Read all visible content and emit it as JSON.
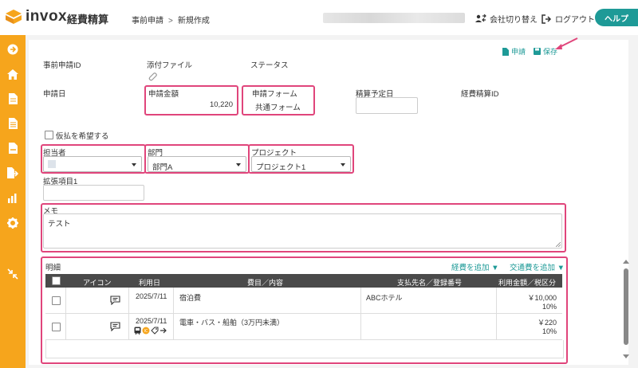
{
  "header": {
    "logo_text": "invox",
    "logo_sub": "経費精算",
    "breadcrumb": [
      "事前申請",
      "新規作成"
    ],
    "breadcrumb_sep": ">",
    "switch_company": "会社切り替え",
    "logout": "ログアウト",
    "help": "ヘルプ"
  },
  "actions": {
    "apply": "申請",
    "save": "保存"
  },
  "form": {
    "pre_app_id_label": "事前申請ID",
    "attachment_label": "添付ファイル",
    "status_label": "ステータス",
    "apply_date_label": "申請日",
    "amount_label": "申請金額",
    "amount_value": "10,220",
    "form_label": "申請フォーム",
    "form_value": "共通フォーム",
    "settle_date_label": "精算予定日",
    "expense_id_label": "経費精算ID",
    "advance_checkbox": "仮払を希望する",
    "person_label": "担当者",
    "dept_label": "部門",
    "dept_value": "部門A",
    "project_label": "プロジェクト",
    "project_value": "プロジェクト1",
    "ext_label": "拡張項目1",
    "memo_label": "メモ",
    "memo_value": "テスト"
  },
  "details": {
    "title": "明細",
    "add_expense": "経費を追加",
    "add_transport": "交通費を追加",
    "columns": [
      "アイコン",
      "利用日",
      "費目／内容",
      "支払先名／登録番号",
      "利用金額／税区分"
    ],
    "rows": [
      {
        "date": "2025/7/11",
        "item": "宿泊費",
        "payee": "ABCホテル",
        "amount": "￥10,000",
        "tax": "10%"
      },
      {
        "date": "2025/7/11",
        "item": "電車・バス・船舶（3万円未満）",
        "payee": "",
        "amount": "￥220",
        "tax": "10%"
      }
    ]
  },
  "colors": {
    "accent": "#1e9a97",
    "sidebar": "#f6a51c",
    "highlight": "#e0457b"
  }
}
